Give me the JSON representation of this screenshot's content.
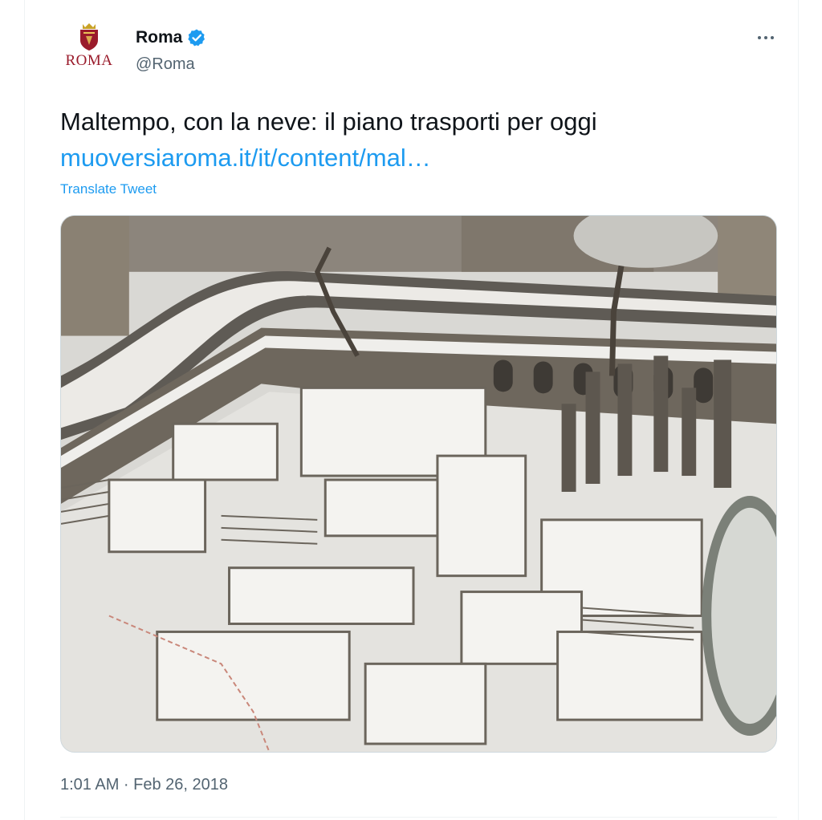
{
  "author": {
    "avatar_label": "ROMA",
    "name": "Roma",
    "handle": "@Roma",
    "verified": true
  },
  "tweet": {
    "text": "Maltempo, con la neve: il piano trasporti per oggi",
    "link": "muoversiaroma.it/it/content/mal…",
    "translate_label": "Translate Tweet",
    "timestamp": "1:01 AM · Feb 26, 2018"
  },
  "colors": {
    "link": "#1d9bf0",
    "verified": "#1d9bf0",
    "secondary_text": "#536471",
    "crest": "#9a1b2b"
  },
  "icons": {
    "verified": "verified-badge-icon",
    "more": "more-dots-icon",
    "avatar": "roma-crest-icon"
  }
}
